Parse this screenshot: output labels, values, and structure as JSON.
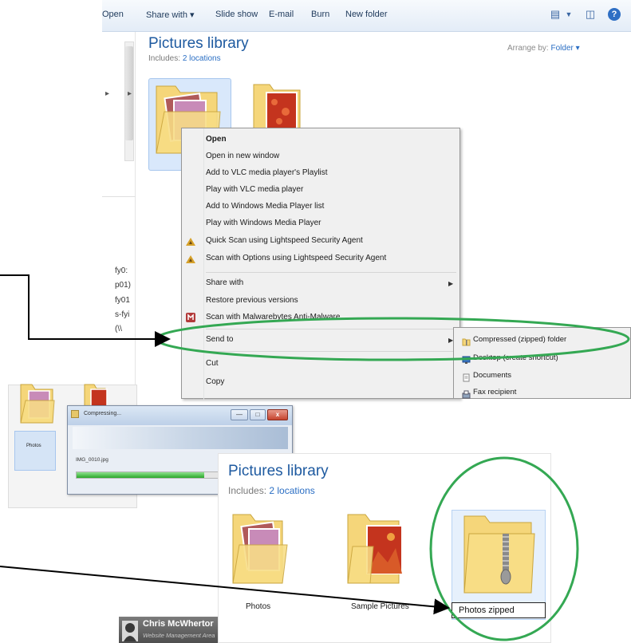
{
  "explorer": {
    "toolbar": {
      "open": "Open",
      "share_with": "Share with ▾",
      "slide_show": "Slide show",
      "email": "E-mail",
      "burn": "Burn",
      "new_folder": "New folder"
    },
    "library_title": "Pictures library",
    "includes_label": "Includes:",
    "includes_link": "2 locations",
    "arrange_label": "Arrange by:",
    "arrange_value": "Folder ▾",
    "nav_truncated": [
      "fy0:",
      "p01)",
      "fy01",
      "s-fyi",
      "(\\\\"
    ]
  },
  "context_menu": {
    "items": [
      "Open",
      "Open in new window",
      "Add to VLC media player's Playlist",
      "Play with VLC media player",
      "Add to Windows Media Player list",
      "Play with Windows Media Player",
      "Quick Scan using Lightspeed Security Agent",
      "Scan with Options using Lightspeed Security Agent",
      "Share with",
      "Restore previous versions",
      "Scan with Malwarebytes Anti-Malware",
      "Send to",
      "Cut",
      "Copy"
    ]
  },
  "send_to_menu": {
    "items": [
      "Compressed (zipped) folder",
      "Desktop (create shortcut)",
      "Documents",
      "Fax recipient"
    ]
  },
  "compress_dialog": {
    "title": "Compressing...",
    "filename": "IMG_0010.jpg",
    "progress": 0.85,
    "min_button": "—",
    "max_button": "□",
    "close_button": "x"
  },
  "thumb_label": "Photos",
  "library2": {
    "title": "Pictures library",
    "includes_label": "Includes:",
    "includes_link": "2 locations",
    "folders": [
      "Photos",
      "Sample Pictures"
    ],
    "rename_value": "Photos zipped"
  },
  "user": {
    "name": "Chris McWhertor",
    "subtitle": "Website Management Area"
  },
  "colors": {
    "highlight_green": "#34a853",
    "library_blue": "#1e5aa0",
    "folder_yellow": "#f5d67a"
  }
}
